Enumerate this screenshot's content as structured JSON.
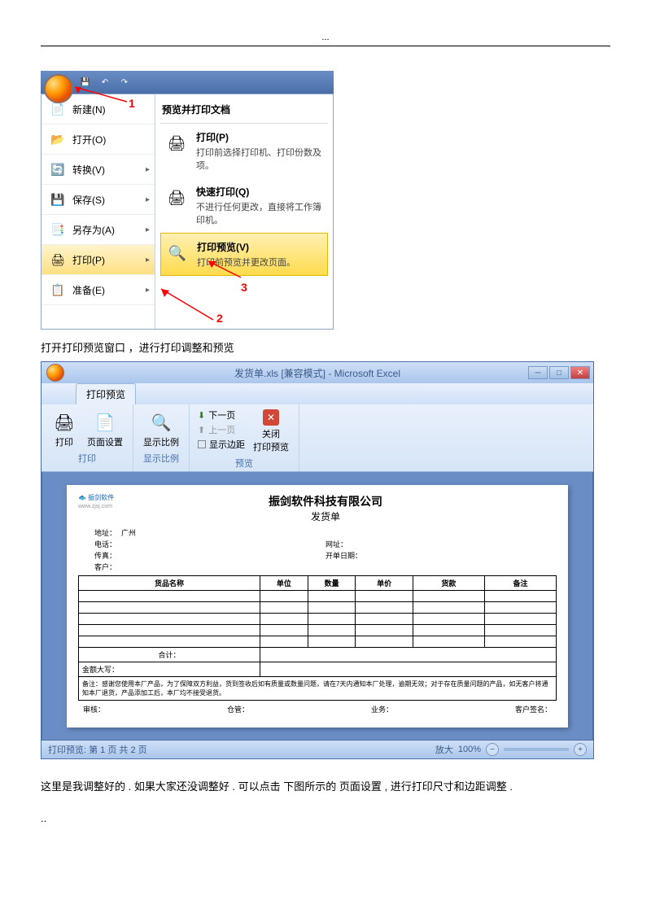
{
  "header_dots": "...",
  "screenshot1": {
    "qat": {
      "save": "💾",
      "undo": "↶",
      "redo": "↷"
    },
    "menu_left": [
      {
        "icon": "📄",
        "label": "新建(N)",
        "arrow": ""
      },
      {
        "icon": "📂",
        "label": "打开(O)",
        "arrow": ""
      },
      {
        "icon": "🔄",
        "label": "转换(V)",
        "arrow": "▸"
      },
      {
        "icon": "💾",
        "label": "保存(S)",
        "arrow": "▸"
      },
      {
        "icon": "📑",
        "label": "另存为(A)",
        "arrow": "▸"
      },
      {
        "icon": "🖨",
        "label": "打印(P)",
        "arrow": "▸"
      },
      {
        "icon": "📋",
        "label": "准备(E)",
        "arrow": "▸"
      }
    ],
    "menu_right_title": "预览并打印文档",
    "sub_items": [
      {
        "icon": "🖨",
        "title": "打印(P)",
        "desc": "打印前选择打印机、打印份数及项。"
      },
      {
        "icon": "🖨",
        "title": "快速打印(Q)",
        "desc": "不进行任何更改，直接将工作簿印机。"
      },
      {
        "icon": "🔍",
        "title": "打印预览(V)",
        "desc": "打印前预览并更改页面。"
      }
    ],
    "anno1": "1",
    "anno2": "2",
    "anno3": "3"
  },
  "caption1": "打开打印预览窗口 ，进行打印调整和预览",
  "screenshot2": {
    "titlebar": "发货单.xls [兼容模式] - Microsoft Excel",
    "tab": "打印预览",
    "ribbon": {
      "print_btn": "打印",
      "page_setup": "页面设置",
      "zoom": "显示比例",
      "next": "下一页",
      "prev": "上一页",
      "margins": "显示边距",
      "close_line1": "关闭",
      "close_line2": "打印预览",
      "group_print": "打印",
      "group_zoom": "显示比例",
      "group_preview": "预览"
    },
    "paper": {
      "logo": "振剑软件",
      "logo_url": "www.zjsj.com",
      "company": "振剑软件科技有限公司",
      "doc_title": "发货单",
      "addr_label": "地址：",
      "addr_val": "广州",
      "tel_label": "电话：",
      "url_label": "网址：",
      "fax_label": "传真：",
      "date_label": "开单日期：",
      "cust_label": "客户：",
      "th1": "货品名称",
      "th2": "单位",
      "th3": "数量",
      "th4": "单价",
      "th5": "货款",
      "th6": "备注",
      "total": "合计：",
      "amount_upper": "金额大写：",
      "note_label": "备注：",
      "note_text": "感谢您使用本厂产品，为了保障双方利益，货到签收后如有质量或数量问题，请在7天内通知本厂处理，逾期无效；对于存在质量问题的产品，如无客户将通知本厂退货，产品添加工后，本厂均不接受退货。",
      "sig1": "审核：",
      "sig2": "仓管：",
      "sig3": "业务：",
      "sig4": "客户签名："
    },
    "status_text": "打印预览: 第 1 页 共 2 页",
    "zoom_label": "放大",
    "zoom_pct": "100%"
  },
  "para2": "这里是我调整好的 . 如果大家还没调整好 . 可以点击 下图所示的 页面设置 , 进行打印尺寸和边距调整 .",
  "footer_dots": ".."
}
